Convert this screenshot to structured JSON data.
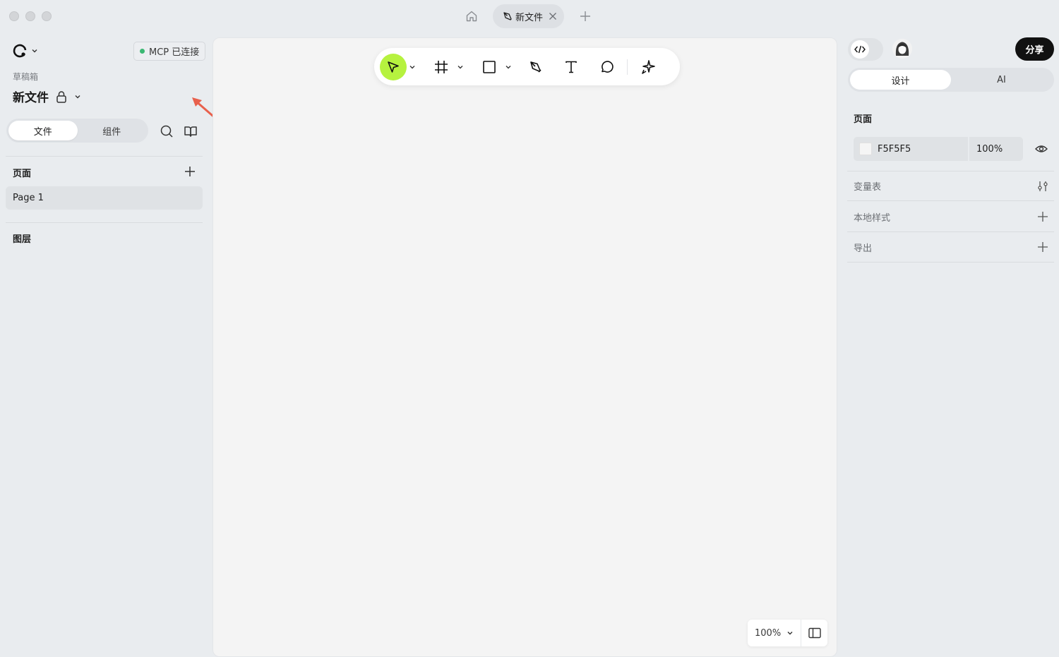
{
  "window": {
    "tab_title": "新文件"
  },
  "left": {
    "mcp_status": "MCP 已连接",
    "folder": "草稿箱",
    "file_name": "新文件",
    "segments": [
      "文件",
      "组件"
    ],
    "pages_title": "页面",
    "pages": [
      "Page 1"
    ],
    "layers_title": "图层"
  },
  "canvas": {
    "zoom": "100%",
    "active_tool": "move"
  },
  "right": {
    "share_label": "分享",
    "tabs": [
      "设计",
      "AI"
    ],
    "page_section": "页面",
    "background_hex": "F5F5F5",
    "background_opacity": "100%",
    "rows": [
      "变量表",
      "本地样式",
      "导出"
    ]
  },
  "colors": {
    "accent": "#b6f23f",
    "status_dot": "#3bb873",
    "share_bg": "#111111",
    "annotation_arrow": "#e8604c"
  }
}
